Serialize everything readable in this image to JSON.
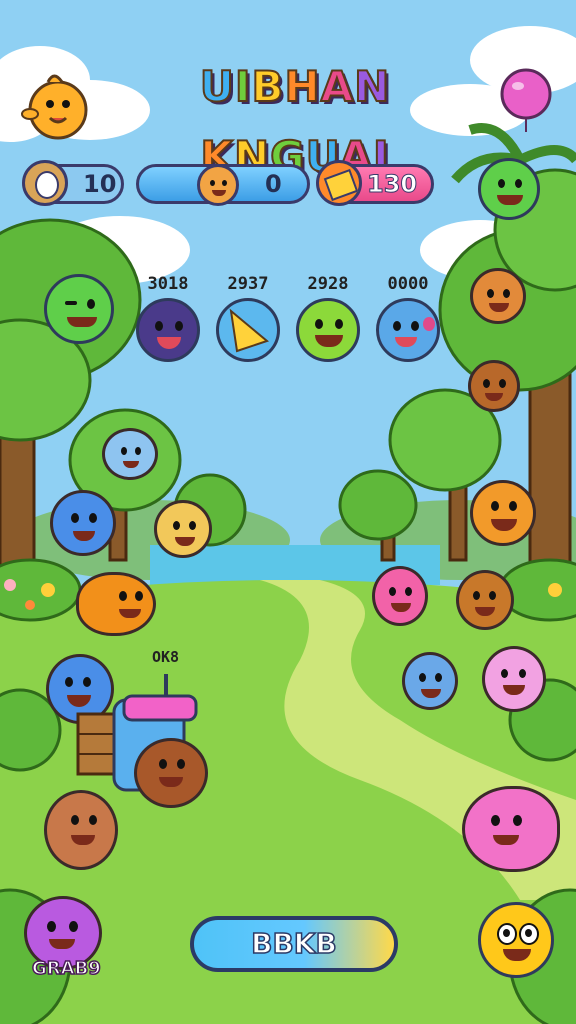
{
  "title": {
    "text": "UIBHAN KNGUAI",
    "letters": [
      "U",
      "I",
      "B",
      "H",
      "A",
      "N",
      " ",
      "K",
      "N",
      "G",
      "U",
      "A",
      "I"
    ]
  },
  "hud": {
    "coins": {
      "value": "10",
      "icon": "coin-icon"
    },
    "character": {
      "value": "0",
      "icon": "critter-face-icon"
    },
    "gems": {
      "value": "130",
      "icon": "gem-icon"
    }
  },
  "targets": [
    {
      "score": "3018",
      "icon": "purple-bear-face-icon"
    },
    {
      "score": "2937",
      "icon": "yellow-triangle-icon"
    },
    {
      "score": "2928",
      "icon": "green-smiley-icon"
    },
    {
      "score": "0000",
      "icon": "blue-fish-face-icon"
    }
  ],
  "field_labels": {
    "near_machine": "OK8"
  },
  "play_button": {
    "label": "BBKB"
  },
  "corner_badge": {
    "label": "GRAB9",
    "icon": "purple-critter-icon"
  },
  "colors": {
    "sky": "#8fd0f3",
    "grass": "#8cd24a",
    "path": "#cde67a",
    "water": "#5cc6e8",
    "outline": "#2e3a5c"
  }
}
